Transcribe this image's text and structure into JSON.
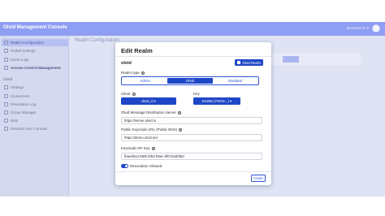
{
  "header": {
    "app_title": "Olvid Management Console",
    "user_name": "devtools/vm ▾"
  },
  "sidebar": {
    "items": [
      {
        "label": "Realm Configuration",
        "icon": "settings-icon"
      },
      {
        "label": "Global Settings",
        "icon": "globe-icon"
      },
      {
        "label": "Event Logs",
        "icon": "log-icon"
      },
      {
        "label": "Access Control Management",
        "icon": "shield-icon"
      }
    ],
    "section": "Olvid",
    "olvid_items": [
      {
        "label": "Settings",
        "icon": "gear-icon"
      },
      {
        "label": "Clusterizers",
        "icon": "cluster-icon"
      },
      {
        "label": "Revocation Log",
        "icon": "revoke-icon"
      },
      {
        "label": "Group Manager",
        "icon": "group-icon"
      },
      {
        "label": "Bots",
        "icon": "bot-icon"
      },
      {
        "label": "External User Console",
        "icon": "console-icon"
      }
    ]
  },
  "main": {
    "title": "Realm Configuration"
  },
  "modal": {
    "title": "Edit Realm",
    "realm_name": "olvid",
    "badge": "Olvid Realm",
    "realm_type_label": "Realm type",
    "realm_types": [
      "Admin",
      "Olvid",
      "Disabled"
    ],
    "client_label": "Client",
    "client_value": "olvid_cl ▾",
    "key_label": "Key",
    "key_value": "ES256 (YW1D...) ▾",
    "distribution_label": "Olvid Message Distribution Server",
    "distribution_value": "https://server.olvid.io",
    "keycloak_url_label": "Public Keycloak URL (Public DNS)",
    "keycloak_url_value": "https://demo.olvid.net",
    "api_key_label": "Keycloak API Key",
    "api_key_value": "fbae9614-b89f-4f63-b9ec-5f07d4d0f6d",
    "revocation_label": "Revocation Allowed",
    "revocation_on": true,
    "close_label": "Close"
  },
  "colors": {
    "accent": "#1e47c8",
    "topbar": "#8e9ef2",
    "overlay": "#dfe3f3"
  }
}
